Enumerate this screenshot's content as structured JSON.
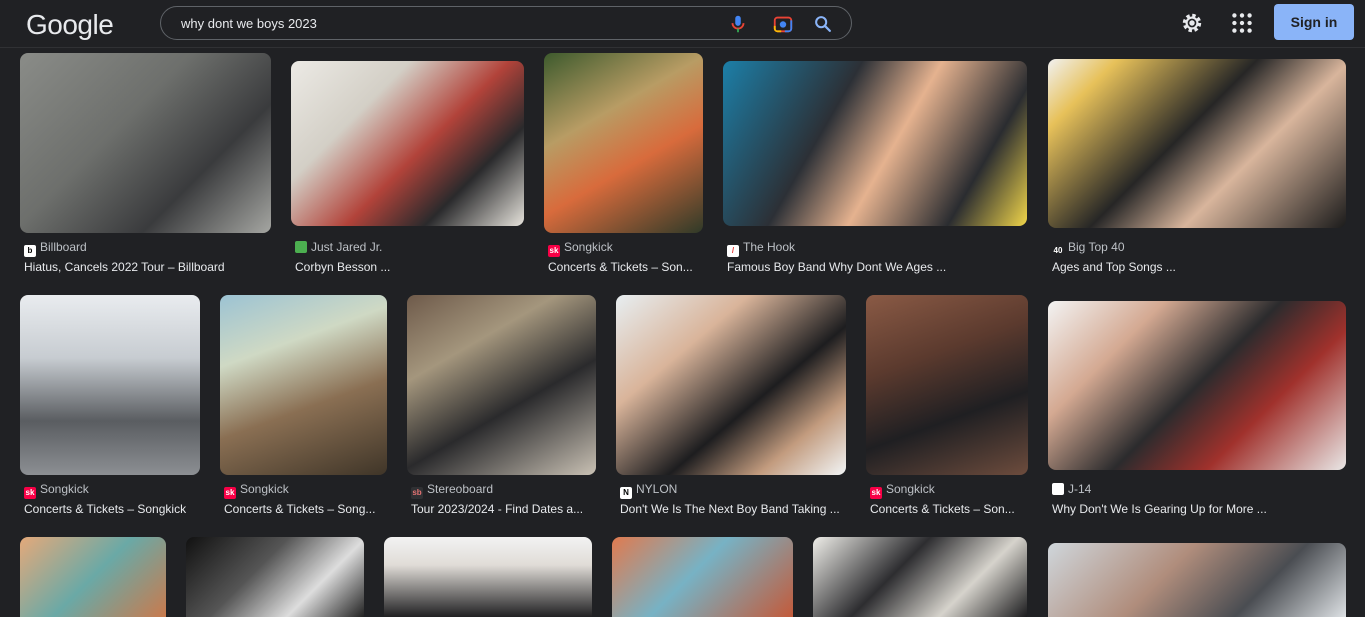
{
  "header": {
    "logo": "Google",
    "search_query": "why dont we boys 2023",
    "signin_label": "Sign in"
  },
  "colors": {
    "background": "#202124",
    "accent": "#8ab4f8"
  },
  "results": [
    {
      "source": "Billboard",
      "title": "Hiatus, Cancels 2022 Tour – Billboard",
      "favicon": "b",
      "fav_color": "#ffffff",
      "fav_text": "#000000"
    },
    {
      "source": "Just Jared Jr.",
      "title": "Corbyn Besson ...",
      "favicon": "",
      "fav_color": "#4caf50",
      "fav_text": "#ffffff"
    },
    {
      "source": "Songkick",
      "title": "Concerts & Tickets – Son...",
      "favicon": "sk",
      "fav_color": "#f80046",
      "fav_text": "#ffffff"
    },
    {
      "source": "The Hook",
      "title": "Famous Boy Band Why Dont We Ages ...",
      "favicon": "/",
      "fav_color": "#ffffff",
      "fav_text": "#e53935"
    },
    {
      "source": "Big Top 40",
      "title": "Ages and Top Songs ...",
      "favicon": "40",
      "fav_color": "#202124",
      "fav_text": "#ffffff"
    },
    {
      "source": "Songkick",
      "title": "Concerts & Tickets – Songkick",
      "favicon": "sk",
      "fav_color": "#f80046",
      "fav_text": "#ffffff"
    },
    {
      "source": "Songkick",
      "title": "Concerts & Tickets – Song...",
      "favicon": "sk",
      "fav_color": "#f80046",
      "fav_text": "#ffffff"
    },
    {
      "source": "Stereoboard",
      "title": "Tour 2023/2024 - Find Dates a...",
      "favicon": "sb",
      "fav_color": "#303134",
      "fav_text": "#e57373"
    },
    {
      "source": "NYLON",
      "title": "Don't We Is The Next Boy Band Taking ...",
      "favicon": "N",
      "fav_color": "#ffffff",
      "fav_text": "#000000"
    },
    {
      "source": "Songkick",
      "title": "Concerts & Tickets – Son...",
      "favicon": "sk",
      "fav_color": "#f80046",
      "fav_text": "#ffffff"
    },
    {
      "source": "J-14",
      "title": "Why Don't We Is Gearing Up for More ...",
      "favicon": "",
      "fav_color": "#ffffff",
      "fav_text": "#e91e63"
    }
  ]
}
